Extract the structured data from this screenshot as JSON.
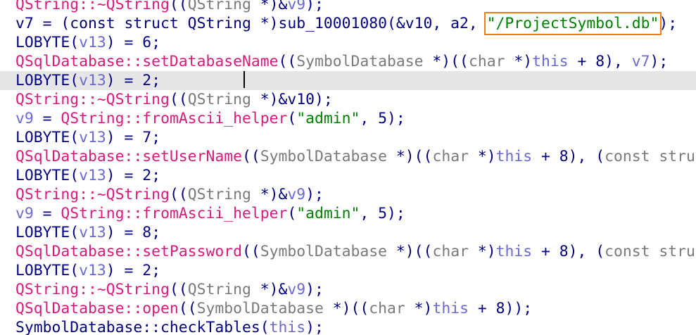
{
  "colors": {
    "function": "#d81b7c",
    "variable": "#6a6ad0",
    "type": "#7a7a7a",
    "string": "#008000",
    "plain": "#000080",
    "highlight_box": "#f07d18",
    "current_line_bg": "#e6e6e6"
  },
  "lines": [
    {
      "tokens": [
        {
          "t": "QString::~QString",
          "c": "fn"
        },
        {
          "t": "((",
          "c": "plain"
        },
        {
          "t": "QString",
          "c": "type"
        },
        {
          "t": " *)&",
          "c": "plain"
        },
        {
          "t": "v9",
          "c": "var"
        },
        {
          "t": ");",
          "c": "plain"
        }
      ]
    },
    {
      "tokens": [
        {
          "t": "v7 = (const struct QString *)sub_10001080(&v10, a2, ",
          "c": "plain"
        },
        {
          "t": "\"/ProjectSymbol.db\"",
          "c": "str",
          "hl": true
        },
        {
          "t": ");",
          "c": "plain"
        }
      ]
    },
    {
      "tokens": [
        {
          "t": "LOBYTE(",
          "c": "plain"
        },
        {
          "t": "v13",
          "c": "var"
        },
        {
          "t": ") = 6;",
          "c": "plain"
        }
      ]
    },
    {
      "tokens": [
        {
          "t": "QSqlDatabase::setDatabaseName",
          "c": "fn"
        },
        {
          "t": "((",
          "c": "plain"
        },
        {
          "t": "SymbolDatabase",
          "c": "type"
        },
        {
          "t": " *)((",
          "c": "plain"
        },
        {
          "t": "char",
          "c": "type"
        },
        {
          "t": " *)",
          "c": "plain"
        },
        {
          "t": "this",
          "c": "var"
        },
        {
          "t": " + 8), ",
          "c": "plain"
        },
        {
          "t": "v7",
          "c": "var"
        },
        {
          "t": ");",
          "c": "plain"
        }
      ]
    },
    {
      "current": true,
      "tokens": [
        {
          "t": "LOBYTE(",
          "c": "plain"
        },
        {
          "t": "v13",
          "c": "var"
        },
        {
          "t": ") = 2;",
          "c": "plain"
        }
      ]
    },
    {
      "tokens": [
        {
          "t": "QString::~QString",
          "c": "fn"
        },
        {
          "t": "((",
          "c": "plain"
        },
        {
          "t": "QString",
          "c": "type"
        },
        {
          "t": " *)&v10);",
          "c": "plain"
        }
      ]
    },
    {
      "tokens": [
        {
          "t": "v9",
          "c": "var"
        },
        {
          "t": " = ",
          "c": "plain"
        },
        {
          "t": "QString::fromAscii_helper",
          "c": "fn"
        },
        {
          "t": "(",
          "c": "plain"
        },
        {
          "t": "\"admin\"",
          "c": "str"
        },
        {
          "t": ", 5);",
          "c": "plain"
        }
      ]
    },
    {
      "tokens": [
        {
          "t": "LOBYTE(",
          "c": "plain"
        },
        {
          "t": "v13",
          "c": "var"
        },
        {
          "t": ") = 7;",
          "c": "plain"
        }
      ]
    },
    {
      "tokens": [
        {
          "t": "QSqlDatabase::setUserName",
          "c": "fn"
        },
        {
          "t": "((",
          "c": "plain"
        },
        {
          "t": "SymbolDatabase",
          "c": "type"
        },
        {
          "t": " *)((",
          "c": "plain"
        },
        {
          "t": "char",
          "c": "type"
        },
        {
          "t": " *)",
          "c": "plain"
        },
        {
          "t": "this",
          "c": "var"
        },
        {
          "t": " + 8), (",
          "c": "plain"
        },
        {
          "t": "const stru",
          "c": "type"
        }
      ]
    },
    {
      "tokens": [
        {
          "t": "LOBYTE(",
          "c": "plain"
        },
        {
          "t": "v13",
          "c": "var"
        },
        {
          "t": ") = 2;",
          "c": "plain"
        }
      ]
    },
    {
      "tokens": [
        {
          "t": "QString::~QString",
          "c": "fn"
        },
        {
          "t": "((",
          "c": "plain"
        },
        {
          "t": "QString",
          "c": "type"
        },
        {
          "t": " *)&",
          "c": "plain"
        },
        {
          "t": "v9",
          "c": "var"
        },
        {
          "t": ");",
          "c": "plain"
        }
      ]
    },
    {
      "tokens": [
        {
          "t": "v9",
          "c": "var"
        },
        {
          "t": " = ",
          "c": "plain"
        },
        {
          "t": "QString::fromAscii_helper",
          "c": "fn"
        },
        {
          "t": "(",
          "c": "plain"
        },
        {
          "t": "\"admin\"",
          "c": "str"
        },
        {
          "t": ", 5);",
          "c": "plain"
        }
      ]
    },
    {
      "tokens": [
        {
          "t": "LOBYTE(",
          "c": "plain"
        },
        {
          "t": "v13",
          "c": "var"
        },
        {
          "t": ") = 8;",
          "c": "plain"
        }
      ]
    },
    {
      "tokens": [
        {
          "t": "QSqlDatabase::setPassword",
          "c": "fn"
        },
        {
          "t": "((",
          "c": "plain"
        },
        {
          "t": "SymbolDatabase",
          "c": "type"
        },
        {
          "t": " *)((",
          "c": "plain"
        },
        {
          "t": "char",
          "c": "type"
        },
        {
          "t": " *)",
          "c": "plain"
        },
        {
          "t": "this",
          "c": "var"
        },
        {
          "t": " + 8), (",
          "c": "plain"
        },
        {
          "t": "const stru",
          "c": "type"
        }
      ]
    },
    {
      "tokens": [
        {
          "t": "LOBYTE(",
          "c": "plain"
        },
        {
          "t": "v13",
          "c": "var"
        },
        {
          "t": ") = 2;",
          "c": "plain"
        }
      ]
    },
    {
      "tokens": [
        {
          "t": "QString::~QString",
          "c": "fn"
        },
        {
          "t": "((",
          "c": "plain"
        },
        {
          "t": "QString",
          "c": "type"
        },
        {
          "t": " *)&",
          "c": "plain"
        },
        {
          "t": "v9",
          "c": "var"
        },
        {
          "t": ");",
          "c": "plain"
        }
      ]
    },
    {
      "tokens": [
        {
          "t": "QSqlDatabase::open",
          "c": "fn"
        },
        {
          "t": "((",
          "c": "plain"
        },
        {
          "t": "SymbolDatabase",
          "c": "type"
        },
        {
          "t": " *)((",
          "c": "plain"
        },
        {
          "t": "char",
          "c": "type"
        },
        {
          "t": " *)",
          "c": "plain"
        },
        {
          "t": "this",
          "c": "var"
        },
        {
          "t": " + 8));",
          "c": "plain"
        }
      ]
    },
    {
      "tokens": [
        {
          "t": "SymbolDatabase::checkTables",
          "c": "plain"
        },
        {
          "t": "(",
          "c": "plain"
        },
        {
          "t": "this",
          "c": "var"
        },
        {
          "t": ");",
          "c": "plain"
        }
      ]
    }
  ]
}
